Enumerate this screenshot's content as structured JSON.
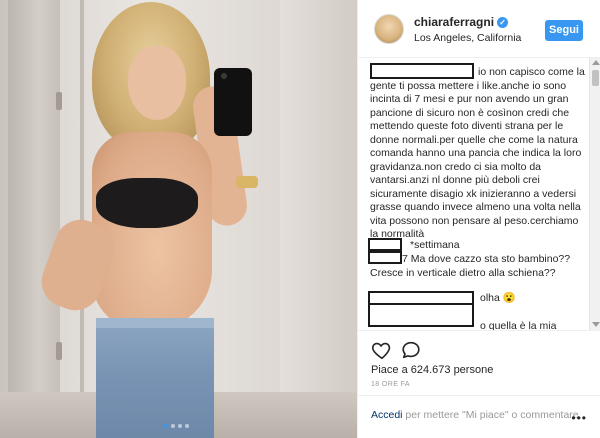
{
  "post": {
    "carousel_dots": 4,
    "active_dot": 0
  },
  "header": {
    "username": "chiaraferragni",
    "verified_mark": "✓",
    "location": "Los Angeles, California",
    "follow_label": "Segui"
  },
  "comments": [
    {
      "text": "io non capisco come la gente ti possa mettere i like.anche io sono incinta di 7 mesi e pur non avendo un gran pancione di sicuro non è cosìnon credi che mettendo queste foto diventi strana per le donne normali.per quelle che come la natura comanda hanno una pancia che indica la loro gravidanza.non credo ci sia molto da vantarsi.anzi nl donne più deboli crei sicuramente disagio xk inizieranno a vedersi grasse quando invece almeno una volta nella vita possono non pensare al peso.cerchiamo la normalità"
    },
    {
      "text": "*settimana"
    },
    {
      "text": "7 Ma dove cazzo sta sto bambino?? Cresce in verticale dietro alla schiena??"
    },
    {
      "text": "olha 😮"
    },
    {
      "text": "o quella è la mia"
    }
  ],
  "actions": {
    "likes_text": "Piace a 624.673 persone",
    "timestamp": "18 ORE FA",
    "login_link": "Accedi",
    "login_suffix": " per mettere \"Mi piace\" o commentare.",
    "more_label": "•••"
  },
  "icons": {
    "heart": "heart-icon",
    "comment": "comment-icon",
    "verified": "verified-badge-icon"
  },
  "colors": {
    "accent": "#3897f0",
    "text": "#262626",
    "muted": "#999999",
    "link": "#003569"
  }
}
